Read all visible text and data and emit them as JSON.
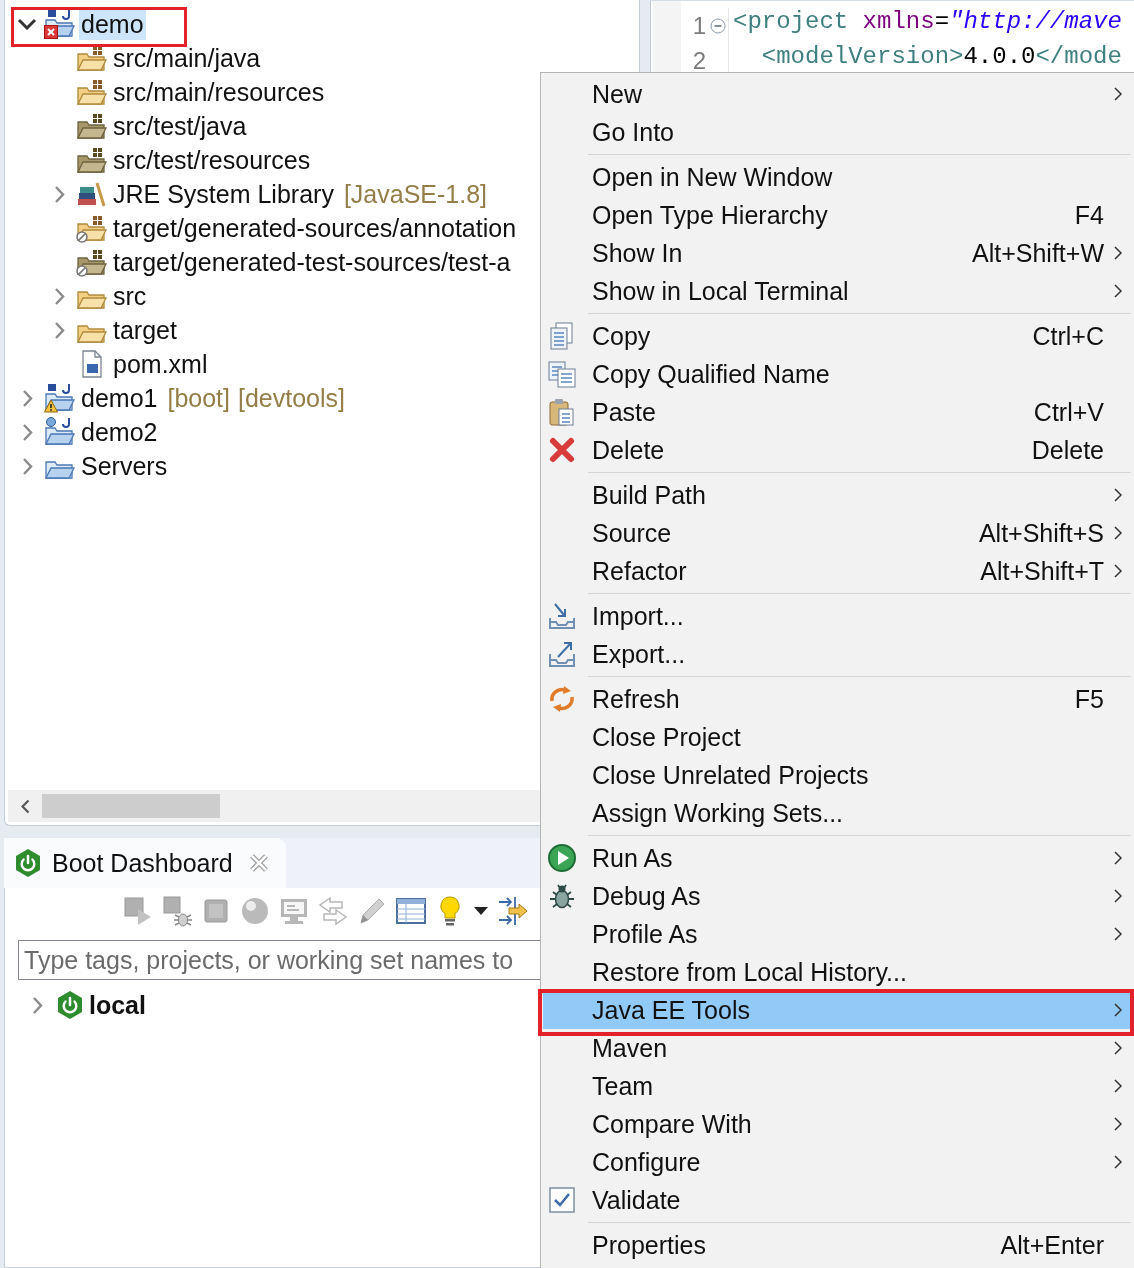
{
  "explorer": {
    "items": [
      {
        "label": "demo",
        "kind": "maven-project",
        "error": true,
        "warning": false,
        "expandable": true,
        "expanded": true,
        "selected": true,
        "outlined": true,
        "children": [
          {
            "label": "src/main/java",
            "kind": "source-folder",
            "expandable": false,
            "selected": false,
            "outlined": false
          },
          {
            "label": "src/main/resources",
            "kind": "source-folder",
            "expandable": false,
            "selected": false,
            "outlined": false
          },
          {
            "label": "src/test/java",
            "kind": "test-source-folder",
            "expandable": false,
            "selected": false,
            "outlined": false
          },
          {
            "label": "src/test/resources",
            "kind": "test-source-folder",
            "expandable": false,
            "selected": false,
            "outlined": false
          },
          {
            "label": "JRE System Library",
            "decorations": [
              "[JavaSE-1.8]"
            ],
            "kind": "library",
            "expandable": true,
            "expanded": false,
            "selected": false,
            "outlined": false
          },
          {
            "label": "target/generated-sources/annotation",
            "kind": "generated-source-folder",
            "expandable": false,
            "selected": false,
            "outlined": false
          },
          {
            "label": "target/generated-test-sources/test-a",
            "kind": "generated-test-folder",
            "expandable": false,
            "selected": false,
            "outlined": false
          },
          {
            "label": "src",
            "kind": "folder",
            "expandable": true,
            "expanded": false,
            "selected": false,
            "outlined": false
          },
          {
            "label": "target",
            "kind": "folder",
            "expandable": true,
            "expanded": false,
            "selected": false,
            "outlined": false
          },
          {
            "label": "pom.xml",
            "kind": "pom-file",
            "expandable": false,
            "selected": false,
            "outlined": false
          }
        ]
      },
      {
        "label": "demo1",
        "decorations": [
          "[boot]",
          "[devtools]"
        ],
        "kind": "maven-project",
        "error": false,
        "warning": true,
        "expandable": true,
        "expanded": false,
        "selected": false,
        "outlined": false
      },
      {
        "label": "demo2",
        "kind": "web-project",
        "error": false,
        "warning": false,
        "expandable": true,
        "expanded": false,
        "selected": false,
        "outlined": false
      },
      {
        "label": "Servers",
        "kind": "servers-folder",
        "error": false,
        "warning": false,
        "expandable": true,
        "expanded": false,
        "selected": false,
        "outlined": false
      }
    ]
  },
  "editor": {
    "lines": [
      {
        "number": "1",
        "foldable": true,
        "indented": false,
        "tokens": [
          {
            "kind": "tag",
            "text": "<project"
          },
          {
            "kind": "attribute",
            "text": " xmlns"
          },
          {
            "kind": "plain",
            "text": "="
          },
          {
            "kind": "string",
            "text": "\"http://mave"
          }
        ]
      },
      {
        "number": "2",
        "foldable": false,
        "indented": true,
        "tokens": [
          {
            "kind": "tag",
            "text": "<modelVersion>"
          },
          {
            "kind": "content",
            "text": "4.0.0"
          },
          {
            "kind": "tag",
            "text": "</mode"
          }
        ]
      }
    ]
  },
  "boot_dashboard": {
    "tab": {
      "title": "Boot Dashboard"
    },
    "toolbar": [
      {
        "kind": "play",
        "disabled": true
      },
      {
        "kind": "bug",
        "disabled": true
      },
      {
        "kind": "stop",
        "disabled": true
      },
      {
        "kind": "sphere",
        "disabled": true
      },
      {
        "kind": "monitor",
        "disabled": true
      },
      {
        "kind": "swap",
        "disabled": true
      },
      {
        "kind": "pencil",
        "disabled": true
      },
      {
        "kind": "table",
        "disabled": false
      },
      {
        "kind": "bulb",
        "disabled": false
      },
      {
        "kind": "caret",
        "disabled": false
      },
      {
        "kind": "arrows",
        "disabled": false
      }
    ],
    "filter": {
      "placeholder": "Type tags, projects, or working set names to"
    },
    "items": [
      {
        "label": "local",
        "kind": "target",
        "expanded": false
      }
    ]
  },
  "context_menu": {
    "sections": [
      {
        "items": [
          {
            "label": "New",
            "kind": "plain",
            "submenu": true,
            "selected": false,
            "outlined": false
          },
          {
            "label": "Go Into",
            "kind": "plain",
            "submenu": false,
            "selected": false,
            "outlined": false
          }
        ]
      },
      {
        "items": [
          {
            "label": "Open in New Window",
            "kind": "plain",
            "submenu": false,
            "selected": false,
            "outlined": false
          },
          {
            "label": "Open Type Hierarchy",
            "kind": "plain",
            "shortcut": "F4",
            "submenu": false,
            "selected": false,
            "outlined": false
          },
          {
            "label": "Show In",
            "kind": "plain",
            "shortcut": "Alt+Shift+W",
            "submenu": true,
            "selected": false,
            "outlined": false
          },
          {
            "label": "Show in Local Terminal",
            "kind": "plain",
            "submenu": true,
            "selected": false,
            "outlined": false
          }
        ]
      },
      {
        "items": [
          {
            "label": "Copy",
            "kind": "copy",
            "shortcut": "Ctrl+C",
            "submenu": false,
            "selected": false,
            "outlined": false
          },
          {
            "label": "Copy Qualified Name",
            "kind": "copy-qualified-name",
            "submenu": false,
            "selected": false,
            "outlined": false
          },
          {
            "label": "Paste",
            "kind": "paste",
            "shortcut": "Ctrl+V",
            "submenu": false,
            "selected": false,
            "outlined": false
          },
          {
            "label": "Delete",
            "kind": "delete",
            "shortcut": "Delete",
            "submenu": false,
            "selected": false,
            "outlined": false
          }
        ]
      },
      {
        "items": [
          {
            "label": "Build Path",
            "kind": "plain",
            "submenu": true,
            "selected": false,
            "outlined": false
          },
          {
            "label": "Source",
            "kind": "plain",
            "shortcut": "Alt+Shift+S",
            "submenu": true,
            "selected": false,
            "outlined": false
          },
          {
            "label": "Refactor",
            "kind": "plain",
            "shortcut": "Alt+Shift+T",
            "submenu": true,
            "selected": false,
            "outlined": false
          }
        ]
      },
      {
        "items": [
          {
            "label": "Import...",
            "kind": "import",
            "submenu": false,
            "selected": false,
            "outlined": false
          },
          {
            "label": "Export...",
            "kind": "export",
            "submenu": false,
            "selected": false,
            "outlined": false
          }
        ]
      },
      {
        "items": [
          {
            "label": "Refresh",
            "kind": "refresh",
            "shortcut": "F5",
            "submenu": false,
            "selected": false,
            "outlined": false
          },
          {
            "label": "Close Project",
            "kind": "plain",
            "submenu": false,
            "selected": false,
            "outlined": false
          },
          {
            "label": "Close Unrelated Projects",
            "kind": "plain",
            "submenu": false,
            "selected": false,
            "outlined": false
          },
          {
            "label": "Assign Working Sets...",
            "kind": "plain",
            "submenu": false,
            "selected": false,
            "outlined": false
          }
        ]
      },
      {
        "items": [
          {
            "label": "Run As",
            "kind": "run",
            "submenu": true,
            "selected": false,
            "outlined": false
          },
          {
            "label": "Debug As",
            "kind": "debug",
            "submenu": true,
            "selected": false,
            "outlined": false
          },
          {
            "label": "Profile As",
            "kind": "plain",
            "submenu": true,
            "selected": false,
            "outlined": false
          },
          {
            "label": "Restore from Local History...",
            "kind": "plain",
            "submenu": false,
            "selected": false,
            "outlined": false
          },
          {
            "label": "Java EE Tools",
            "kind": "plain",
            "submenu": true,
            "selected": true,
            "outlined": true
          },
          {
            "label": "Maven",
            "kind": "plain",
            "submenu": true,
            "selected": false,
            "outlined": false
          },
          {
            "label": "Team",
            "kind": "plain",
            "submenu": true,
            "selected": false,
            "outlined": false
          },
          {
            "label": "Compare With",
            "kind": "plain",
            "submenu": true,
            "selected": false,
            "outlined": false
          },
          {
            "label": "Configure",
            "kind": "plain",
            "submenu": true,
            "selected": false,
            "outlined": false
          },
          {
            "label": "Validate",
            "kind": "validate",
            "submenu": false,
            "selected": false,
            "outlined": false
          }
        ]
      },
      {
        "items": [
          {
            "label": "Properties",
            "kind": "plain",
            "shortcut": "Alt+Enter",
            "submenu": false,
            "selected": false,
            "outlined": false
          }
        ]
      }
    ]
  }
}
